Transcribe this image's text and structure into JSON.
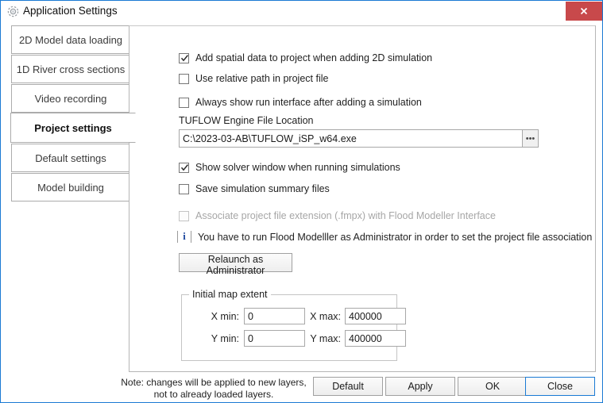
{
  "window": {
    "title": "Application Settings",
    "gear_icon": "gear-icon",
    "close_label": "×",
    "accent_border": "#1a7ad4",
    "close_button_color": "#c8494b"
  },
  "tabs": [
    {
      "label": "2D Model data loading",
      "active": false
    },
    {
      "label": "1D River cross sections",
      "active": false
    },
    {
      "label": "Video recording",
      "active": false
    },
    {
      "label": "Project settings",
      "active": true
    },
    {
      "label": "Default settings",
      "active": false
    },
    {
      "label": "Model building",
      "active": false
    }
  ],
  "panel": {
    "checkboxes": [
      {
        "label": "Add spatial data to project when adding 2D simulation",
        "checked": true,
        "disabled": false
      },
      {
        "label": "Use relative path in project file",
        "checked": false,
        "disabled": false
      },
      {
        "label": "Always show run interface after adding a simulation",
        "checked": false,
        "disabled": false
      },
      {
        "label": "Show solver window when running simulations",
        "checked": true,
        "disabled": false
      },
      {
        "label": "Save simulation summary files",
        "checked": false,
        "disabled": false
      },
      {
        "label": "Associate project file extension (.fmpx) with Flood Modeller Interface",
        "checked": false,
        "disabled": true
      }
    ],
    "engine": {
      "label": "TUFLOW Engine File Location",
      "value": "C:\\2023-03-AB\\TUFLOW_iSP_w64.exe",
      "placeholder": "",
      "browse_label": "•••"
    },
    "info": {
      "icon": "i",
      "text": "You have to run Flood Modelller as Administrator in order to set the project file association",
      "color": "#17429b"
    },
    "relaunch_label": "Relaunch as Administrator",
    "map_extent": {
      "title": "Initial map extent",
      "fields": [
        {
          "label": "X min:",
          "value": "0"
        },
        {
          "label": "X max:",
          "value": "400000"
        },
        {
          "label": "Y min:",
          "value": "0"
        },
        {
          "label": "Y max:",
          "value": "400000"
        }
      ]
    }
  },
  "footer": {
    "note_line1": "Note: changes will be applied to new layers,",
    "note_line2": "not to already loaded layers.",
    "buttons": [
      {
        "label": "Default",
        "focused": false
      },
      {
        "label": "Apply",
        "focused": false
      },
      {
        "label": "OK",
        "focused": false
      },
      {
        "label": "Close",
        "focused": true
      }
    ]
  }
}
